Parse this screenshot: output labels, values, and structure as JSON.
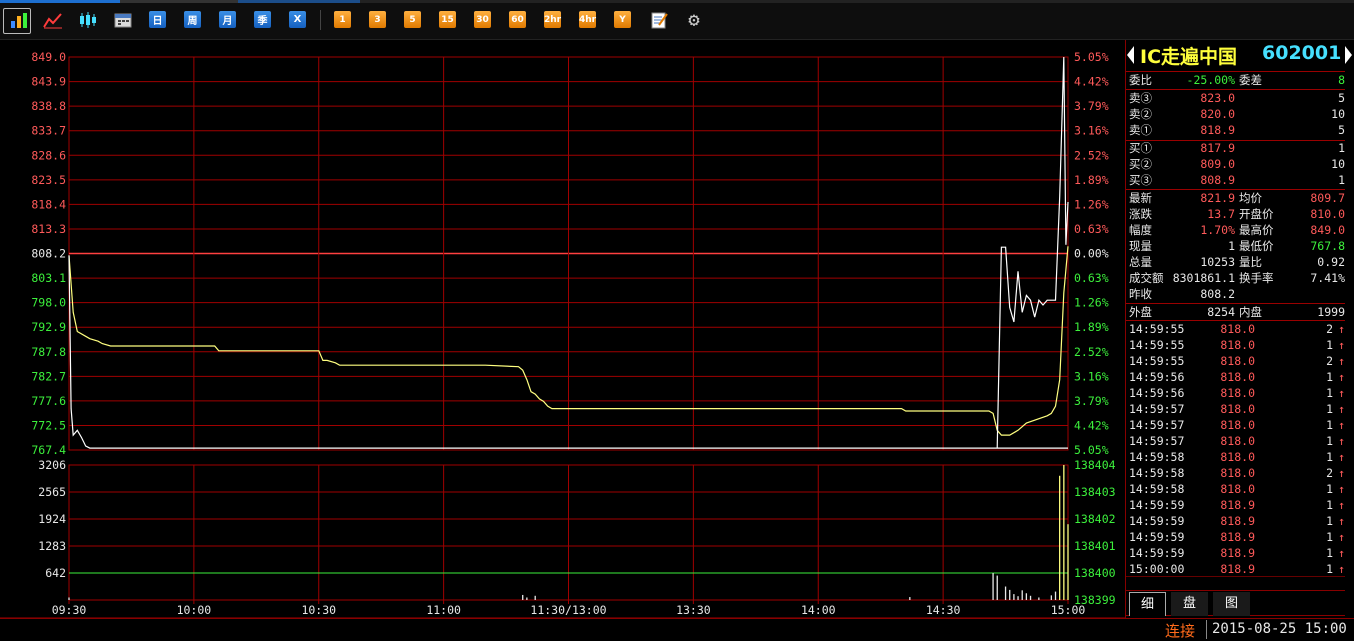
{
  "toolbar": {
    "icons": [
      "bar-chart-icon",
      "line-chart-icon",
      "candlestick-icon",
      "calendar-icon"
    ],
    "periods_blue": [
      "日",
      "周",
      "月",
      "季",
      "X"
    ],
    "periods_orange": [
      "1",
      "3",
      "5",
      "15",
      "30",
      "60",
      "2hr",
      "4hr",
      "Y"
    ],
    "tools": [
      "notepad-icon",
      "gear-icon"
    ]
  },
  "title": {
    "name": "IC走遍中国",
    "code": "602001"
  },
  "colors": {
    "up": "#ff5a5a",
    "down": "#3cf03c",
    "grid": "#a00000",
    "price": "#ffffff",
    "avg": "#ffff80"
  },
  "order_book": {
    "webi": {
      "label": "委比",
      "value": "-25.00%"
    },
    "weicha": {
      "label": "委差",
      "value": "8"
    },
    "asks": [
      {
        "label": "卖③",
        "price": "823.0",
        "vol": "5"
      },
      {
        "label": "卖②",
        "price": "820.0",
        "vol": "10"
      },
      {
        "label": "卖①",
        "price": "818.9",
        "vol": "5"
      }
    ],
    "bids": [
      {
        "label": "买①",
        "price": "817.9",
        "vol": "1"
      },
      {
        "label": "买②",
        "price": "809.0",
        "vol": "10"
      },
      {
        "label": "买③",
        "price": "808.9",
        "vol": "1"
      }
    ]
  },
  "quote": [
    {
      "l1": "最新",
      "v1": "821.9",
      "c1": "up",
      "l2": "均价",
      "v2": "809.7",
      "c2": "up"
    },
    {
      "l1": "涨跌",
      "v1": "13.7",
      "c1": "up",
      "l2": "开盘价",
      "v2": "810.0",
      "c2": "up"
    },
    {
      "l1": "幅度",
      "v1": "1.70%",
      "c1": "up",
      "l2": "最高价",
      "v2": "849.0",
      "c2": "up"
    },
    {
      "l1": "现量",
      "v1": "1",
      "c1": "white",
      "l2": "最低价",
      "v2": "767.8",
      "c2": "down"
    },
    {
      "l1": "总量",
      "v1": "10253",
      "c1": "white",
      "l2": "量比",
      "v2": "0.92",
      "c2": "white"
    },
    {
      "l1": "成交额",
      "v1": "8301861.1",
      "c1": "white",
      "l2": "换手率",
      "v2": "7.41%",
      "c2": "white"
    },
    {
      "l1": "昨收",
      "v1": "808.2",
      "c1": "white",
      "l2": "",
      "v2": "",
      "c2": "white"
    }
  ],
  "outin": {
    "l1": "外盘",
    "v1": "8254",
    "l2": "内盘",
    "v2": "1999"
  },
  "ticks": [
    {
      "time": "14:59:55",
      "price": "818.0",
      "vol": "2"
    },
    {
      "time": "14:59:55",
      "price": "818.0",
      "vol": "1"
    },
    {
      "time": "14:59:55",
      "price": "818.0",
      "vol": "2"
    },
    {
      "time": "14:59:56",
      "price": "818.0",
      "vol": "1"
    },
    {
      "time": "14:59:56",
      "price": "818.0",
      "vol": "1"
    },
    {
      "time": "14:59:57",
      "price": "818.0",
      "vol": "1"
    },
    {
      "time": "14:59:57",
      "price": "818.0",
      "vol": "1"
    },
    {
      "time": "14:59:57",
      "price": "818.0",
      "vol": "1"
    },
    {
      "time": "14:59:58",
      "price": "818.0",
      "vol": "1"
    },
    {
      "time": "14:59:58",
      "price": "818.0",
      "vol": "2"
    },
    {
      "time": "14:59:58",
      "price": "818.0",
      "vol": "1"
    },
    {
      "time": "14:59:59",
      "price": "818.9",
      "vol": "1"
    },
    {
      "time": "14:59:59",
      "price": "818.9",
      "vol": "1"
    },
    {
      "time": "14:59:59",
      "price": "818.9",
      "vol": "1"
    },
    {
      "time": "14:59:59",
      "price": "818.9",
      "vol": "1"
    },
    {
      "time": "15:00:00",
      "price": "818.9",
      "vol": "1"
    }
  ],
  "tick_arrow": "↑",
  "tabs": [
    "细",
    "盘",
    "图"
  ],
  "status": {
    "connection": "连接",
    "datetime": "2015-08-25 15:00"
  },
  "chart_data": {
    "type": "line",
    "prev_close": 808.2,
    "price_ticks": [
      "849.0",
      "843.9",
      "838.8",
      "833.7",
      "828.6",
      "823.5",
      "818.4",
      "813.3",
      "808.2",
      "803.1",
      "798.0",
      "792.9",
      "787.8",
      "782.7",
      "777.6",
      "772.5",
      "767.4"
    ],
    "pct_ticks": [
      "5.05%",
      "4.42%",
      "3.79%",
      "3.16%",
      "2.52%",
      "1.89%",
      "1.26%",
      "0.63%",
      "0.00%",
      "0.63%",
      "1.26%",
      "1.89%",
      "2.52%",
      "3.16%",
      "3.79%",
      "4.42%",
      "5.05%"
    ],
    "ylim": [
      767.4,
      849.0
    ],
    "vol_ticks": [
      "3206",
      "2565",
      "1924",
      "1283",
      "642"
    ],
    "vol_right_ticks": [
      "138404",
      "138403",
      "138402",
      "138401",
      "138400",
      "138399"
    ],
    "vol_ylim": [
      0,
      3206
    ],
    "x_labels": [
      "09:30",
      "10:00",
      "10:30",
      "11:00",
      "11:30/13:00",
      "13:30",
      "14:00",
      "14:30",
      "15:00"
    ],
    "minutes_total": 240,
    "price_series": {
      "name": "price",
      "x": [
        0,
        0.5,
        1,
        2,
        3,
        4,
        5,
        240
      ],
      "y": [
        807.8,
        776.0,
        770.5,
        771.5,
        770.0,
        768.2,
        767.8,
        767.8
      ],
      "x2": [
        223,
        224,
        225,
        226,
        227,
        228,
        229,
        230,
        231,
        232,
        233,
        234,
        235,
        236,
        237,
        238,
        239,
        239.5,
        240
      ],
      "y2": [
        767.8,
        809.5,
        809.5,
        797.0,
        794.0,
        804.5,
        796.0,
        799.5,
        798.5,
        795.0,
        798.5,
        797.5,
        798.5,
        798.5,
        798.5,
        820.0,
        849.0,
        810.0,
        818.9
      ]
    },
    "avg_series": {
      "name": "avg",
      "x": [
        0,
        1,
        2,
        4,
        5,
        7,
        8,
        10,
        15,
        20,
        35,
        36,
        37,
        40,
        45,
        60,
        61,
        62,
        64,
        65,
        80,
        100,
        108,
        109,
        110,
        111,
        112,
        113,
        114,
        115,
        116,
        140,
        160,
        180,
        200,
        201,
        210,
        220,
        221,
        222,
        223,
        224,
        226,
        228,
        230,
        235,
        236,
        237,
        238,
        239,
        240
      ],
      "y": [
        807.8,
        796.0,
        792.0,
        791.0,
        790.5,
        790.0,
        789.5,
        789.0,
        789.0,
        789.0,
        789.0,
        788.0,
        788.0,
        788.0,
        788.0,
        788.0,
        786.0,
        786.0,
        785.5,
        785.0,
        785.0,
        785.0,
        784.7,
        784.0,
        782.0,
        779.5,
        779.0,
        778.0,
        777.5,
        776.5,
        776.0,
        776.0,
        776.0,
        776.0,
        776.0,
        775.5,
        775.5,
        775.5,
        775.5,
        775.0,
        771.5,
        770.5,
        770.5,
        771.5,
        773.0,
        774.5,
        775.0,
        776.5,
        782.0,
        800.0,
        809.7
      ]
    },
    "volume_bars": [
      {
        "m": 0,
        "v": 60
      },
      {
        "m": 109,
        "v": 120
      },
      {
        "m": 110,
        "v": 60
      },
      {
        "m": 112,
        "v": 100
      },
      {
        "m": 202,
        "v": 70
      },
      {
        "m": 222,
        "v": 640
      },
      {
        "m": 223,
        "v": 580
      },
      {
        "m": 225,
        "v": 320
      },
      {
        "m": 226,
        "v": 240
      },
      {
        "m": 227,
        "v": 140
      },
      {
        "m": 228,
        "v": 90
      },
      {
        "m": 229,
        "v": 230
      },
      {
        "m": 230,
        "v": 160
      },
      {
        "m": 231,
        "v": 100
      },
      {
        "m": 233,
        "v": 60
      },
      {
        "m": 236,
        "v": 110
      },
      {
        "m": 237,
        "v": 200
      },
      {
        "m": 238,
        "v": 2950
      },
      {
        "m": 239,
        "v": 3206
      },
      {
        "m": 240,
        "v": 1800
      }
    ],
    "volume_avg_level": 642
  }
}
